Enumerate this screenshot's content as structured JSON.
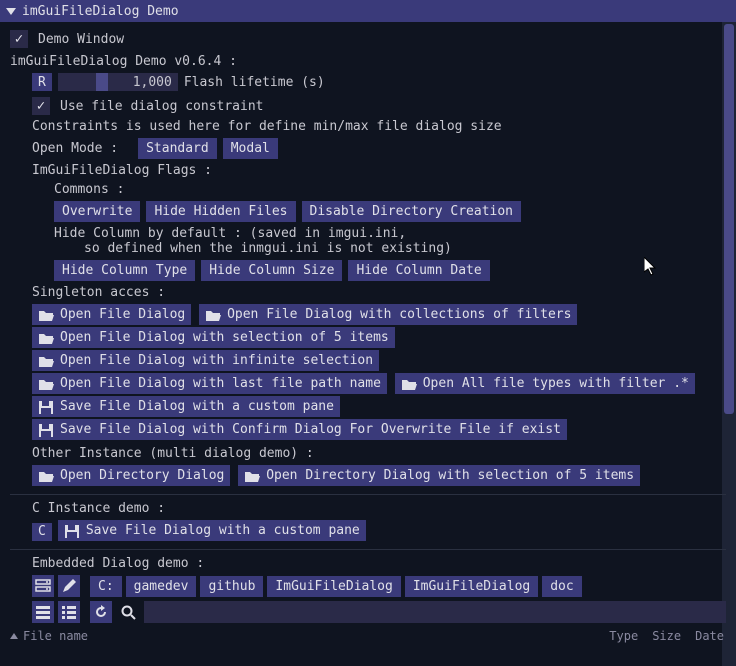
{
  "window": {
    "title": "imGuiFileDialog Demo"
  },
  "demoWindow": {
    "label": "Demo Window"
  },
  "version": "imGuiFileDialog Demo v0.6.4 :",
  "flash": {
    "r_btn": "R",
    "value": "1,000",
    "label": "Flash lifetime (s)"
  },
  "useConstraint": {
    "label": "Use file dialog constraint"
  },
  "constraintDesc": "Constraints is used here for define min/max file dialog size",
  "openModeLabel": "Open Mode :",
  "openModes": [
    "Standard",
    "Modal"
  ],
  "flagsLabel": "ImGuiFileDialog Flags :",
  "commonsLabel": "Commons :",
  "commonFlags": [
    "Overwrite",
    "Hide Hidden Files",
    "Disable Directory Creation"
  ],
  "hideColDesc1": "Hide Column by default : (saved in imgui.ini,",
  "hideColDesc2": "so defined when the inmgui.ini is not existing)",
  "hideColFlags": [
    "Hide Column Type",
    "Hide Column Size",
    "Hide Column Date"
  ],
  "singletonLabel": "Singleton acces :",
  "singletonButtons": [
    "Open File Dialog",
    "Open File Dialog with collections of filters",
    "Open File Dialog with selection of 5 items",
    "Open File Dialog with infinite selection",
    "Open File Dialog with last file path name",
    "Open All file types with filter .*",
    "Save File Dialog with a custom pane",
    "Save File Dialog with Confirm Dialog For Overwrite File if exist"
  ],
  "otherLabel": "Other Instance (multi dialog demo) :",
  "otherButtons": [
    "Open Directory Dialog",
    "Open Directory Dialog with selection of 5 items"
  ],
  "cInstanceLabel": "C Instance demo :",
  "cInstance": {
    "c_btn": "C",
    "label": "Save File Dialog with a custom pane"
  },
  "embeddedLabel": "Embedded Dialog demo :",
  "breadcrumbs": [
    "C:",
    "gamedev",
    "github",
    "ImGuiFileDialog",
    "ImGuiFileDialog",
    "doc"
  ],
  "tableHead": {
    "name": "File name",
    "type": "Type",
    "size": "Size",
    "date": "Date"
  }
}
